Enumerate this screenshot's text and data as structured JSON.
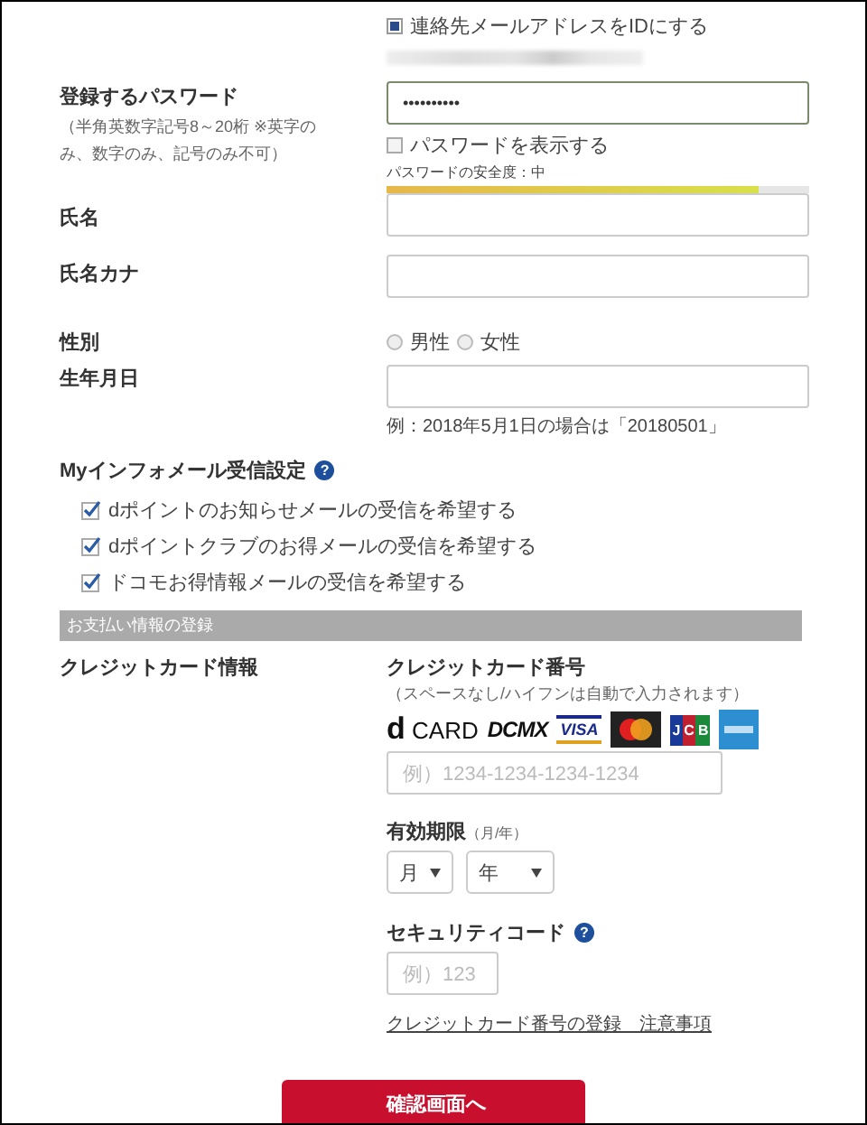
{
  "id_option": {
    "label": "連絡先メールアドレスをIDにする",
    "checked": true
  },
  "password": {
    "label": "登録するパスワード",
    "note": "（半角英数字記号8～20桁 ※英字のみ、数字のみ、記号のみ不可）",
    "value": "••••••••••",
    "show_label": "パスワードを表示する",
    "show_checked": false,
    "strength_label": "パスワードの安全度：中",
    "level": 0.88
  },
  "name": {
    "label": "氏名"
  },
  "kana": {
    "label": "氏名カナ"
  },
  "gender": {
    "label": "性別",
    "options": [
      {
        "label": "男性",
        "selected": false
      },
      {
        "label": "女性",
        "selected": false
      }
    ]
  },
  "birthday": {
    "label": "生年月日",
    "hint": "例：2018年5月1日の場合は「20180501」"
  },
  "mail_settings": {
    "title": "Myインフォメール受信設定",
    "help": "?",
    "options": [
      {
        "label": "dポイントのお知らせメールの受信を希望する",
        "checked": true
      },
      {
        "label": "dポイントクラブのお得メールの受信を希望する",
        "checked": true
      },
      {
        "label": "ドコモお得情報メールの受信を希望する",
        "checked": true
      }
    ]
  },
  "payment_section": {
    "title": "お支払い情報の登録"
  },
  "credit": {
    "label": "クレジットカード情報",
    "number_label": "クレジットカード番号",
    "number_note": "（スペースなし/ハイフンは自動で入力されます）",
    "brands": [
      {
        "kind": "dcard",
        "mark": "d",
        "label": "CARD"
      },
      {
        "kind": "dcmx",
        "label": "DCMX"
      },
      {
        "kind": "visa",
        "label": "VISA"
      },
      {
        "kind": "mastercard"
      },
      {
        "kind": "jcb",
        "label": "JCB"
      },
      {
        "kind": "amex"
      }
    ],
    "number_placeholder": "例）1234-1234-1234-1234",
    "expiry_label": "有効期限",
    "expiry_unit": "（月/年）",
    "month": "月",
    "year": "年",
    "security_label": "セキュリティコード",
    "security_help": "?",
    "security_placeholder": "例）123",
    "link": "クレジットカード番号の登録　注意事項"
  },
  "submit": "確認画面へ"
}
